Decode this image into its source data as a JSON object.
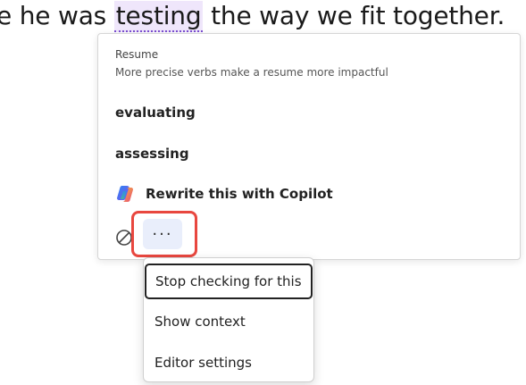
{
  "document": {
    "text_before": "e he was",
    "flagged_word": "testing",
    "text_after": "the way we fit together."
  },
  "editor_card": {
    "category": "Resume",
    "subtitle": "More precise verbs make a resume more impactful",
    "suggestions": [
      "evaluating",
      "assessing"
    ],
    "copilot_label": "Rewrite this with Copilot",
    "more_label": "···"
  },
  "context_menu": {
    "items": [
      "Stop checking for this",
      "Show context",
      "Editor settings"
    ]
  },
  "colors": {
    "highlight_outline": "#e8473f",
    "flag_background": "#efe6fb",
    "more_button_bg": "#e9eefb"
  },
  "icons": {
    "copilot": "copilot-icon",
    "ignore": "ignore-icon"
  }
}
